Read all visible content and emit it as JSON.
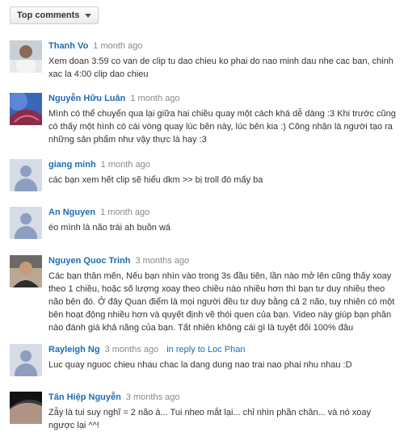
{
  "sort": {
    "label": "Top comments",
    "icon": "chevron-down-icon"
  },
  "comments": [
    {
      "author": "Thanh Vo",
      "time": "1 month ago",
      "text": "Xem doan 3:59 co van de clip tu dao chieu ko phai do nao minh dau nhe cac ban, chinh xac la 4:00 clip dao chieu"
    },
    {
      "author": "Nguyễn Hữu Luân",
      "time": "1 month ago",
      "text": "Mình có thể chuyển qua lại giữa hai chiều quay một cách khá dễ dàng :3 Khi trước cũng có thấy một hình có cái vòng quay lúc bên này, lúc bên kia :) Công nhận là người tạo ra những sản phẩm như vậy thực là hay :3"
    },
    {
      "author": "giang minh",
      "time": "1 month ago",
      "text": "các bạn xem hết clip sẽ hiểu dkm >> bị troll đó mấy ba"
    },
    {
      "author": "An Nguyen",
      "time": "1 month ago",
      "text": "éo mình là não trái ah buồn wá"
    },
    {
      "author": "Nguyen Quoc Trinh",
      "time": "3 months ago",
      "text": "Các bạn thân mến, Nếu bạn nhìn vào trong 3s đầu tiên, lần nào mở lên cũng thấy xoay theo 1 chiều, hoặc số lượng xoay theo chiều nào nhiều hơn thì bạn tư duy nhiều theo não bên đó. Ở đây Quan điểm là mọi người đều tư duy bằng cả 2 não, tuy nhiên có một bên hoạt động nhiều hơn và quyết định về thói quen của bạn. Video này giúp bạn phần nào đánh giá khả năng của bạn. Tất nhiên không cái gì là tuyệt đối 100% đâu"
    },
    {
      "author": "Rayleigh Ng",
      "time": "3 months ago",
      "reply_to": "in reply to Loc Phan",
      "text": "Luc quay nguoc chieu nhau chac la dang dung nao trai nao phai nhu nhau :D"
    },
    {
      "author": "Tấn Hiệp Nguyễn",
      "time": "3 months ago",
      "text": "Zẫy là tui suy nghĩ = 2 não à... Tui nheo mắt lại... chỉ nhìn phần chân... và nó xoay ngược lại ^^!"
    }
  ],
  "colors": {
    "author_link": "#1f6bb5",
    "timestamp": "#888888",
    "text": "#333333"
  }
}
